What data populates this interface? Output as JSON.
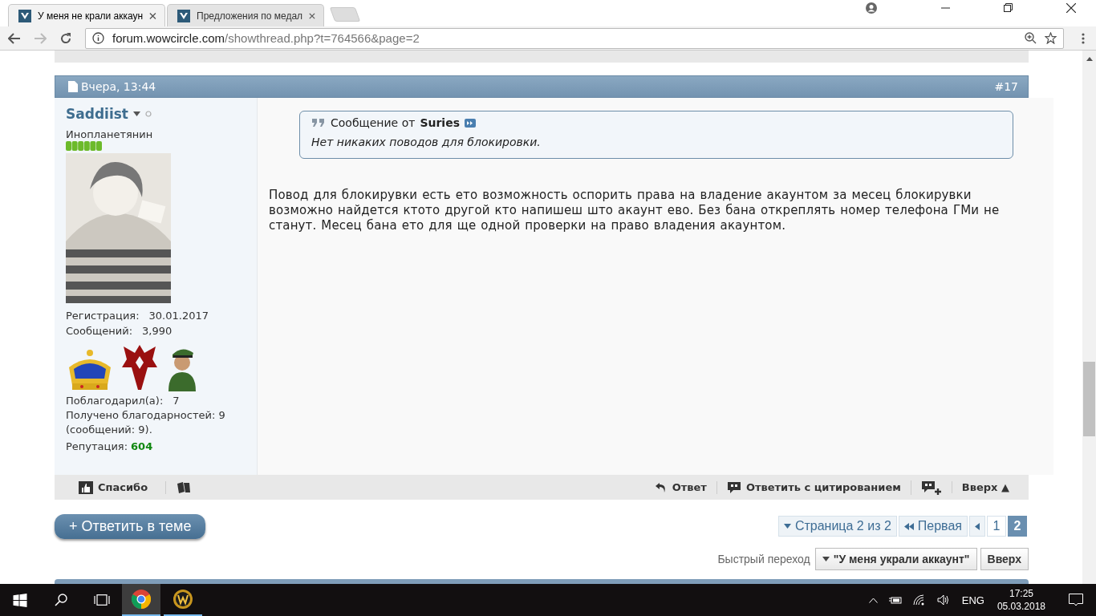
{
  "browser": {
    "tabs": [
      {
        "title": "У меня не крали аккаун",
        "selected": true
      },
      {
        "title": "Предложения по медал",
        "selected": false
      }
    ],
    "url_host": "forum.wowcircle.com",
    "url_path": "/showthread.php?t=764566&page=2"
  },
  "post": {
    "date": "Вчера, 13:44",
    "number": "#17",
    "user": {
      "name": "Saddiist",
      "online": false,
      "title": "Инопланетянин",
      "info": [
        {
          "label": "Регистрация:",
          "value": "30.01.2017"
        },
        {
          "label": "Сообщений:",
          "value": "3,990"
        }
      ],
      "thanked": {
        "label": "Поблагодарил(а):",
        "value": "7"
      },
      "received": "Получено благодарностей: 9 (сообщений: 9).",
      "reputation": {
        "label": "Репутация:",
        "value": "604"
      }
    },
    "quote": {
      "label": "Сообщение от",
      "author": "Suries",
      "text": "Нет никаких поводов для блокировки."
    },
    "message": "Повод для блокирувки есть ето возможность оспорить права на владение акаунтом за месец блокирувки возможно найдется ктото другой кто напишеш што акаунт ево. Без бана откреплять номер телефона ГМи не станут. Месец бана ето для ще одной проверки на право владения акаунтом."
  },
  "post_bar": {
    "thanks": "Спасибо",
    "reply": "Ответ",
    "quote": "Ответить с цитированием",
    "up": "Вверх ▲"
  },
  "reply_button": "+ Ответить в теме",
  "pagination": {
    "label": "Страница 2 из 2",
    "first": "Первая",
    "pages": [
      {
        "label": "1",
        "selected": false
      },
      {
        "label": "2",
        "selected": true
      }
    ]
  },
  "quick_nav": {
    "label": "Быстрый переход",
    "thread": "\"У меня украли аккаунт\"",
    "up": "Вверх"
  },
  "taskbar": {
    "apps": [
      {
        "kind": "chrome",
        "selected": true
      },
      {
        "kind": "wow",
        "selected": false
      }
    ],
    "language": "ENG",
    "time": "17:25",
    "date": "05.03.2018"
  }
}
